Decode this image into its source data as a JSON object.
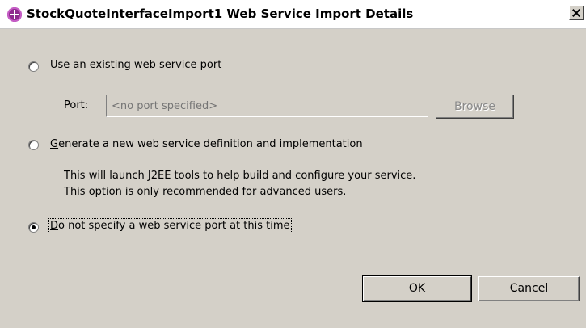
{
  "window": {
    "title": "StockQuoteInterfaceImport1 Web Service Import Details"
  },
  "options": [
    {
      "mnemonic": "U",
      "rest": "se an existing web service port",
      "selected": false
    },
    {
      "mnemonic": "G",
      "rest": "enerate a new web service definition and implementation",
      "selected": false
    },
    {
      "mnemonic": "D",
      "rest": "o not specify a web service port at this time",
      "selected": true
    }
  ],
  "port": {
    "label": "Port:",
    "placeholder": "<no port specified>",
    "browse_mnemonic": "B",
    "browse_rest": "rowse"
  },
  "generate_description": {
    "line1": "This will launch J2EE tools to help build and configure your service.",
    "line2": "This option is only recommended for advanced users."
  },
  "buttons": {
    "ok": "OK",
    "cancel": "Cancel"
  },
  "icons": {
    "app": "websphere-add-icon",
    "close": "close-icon"
  }
}
